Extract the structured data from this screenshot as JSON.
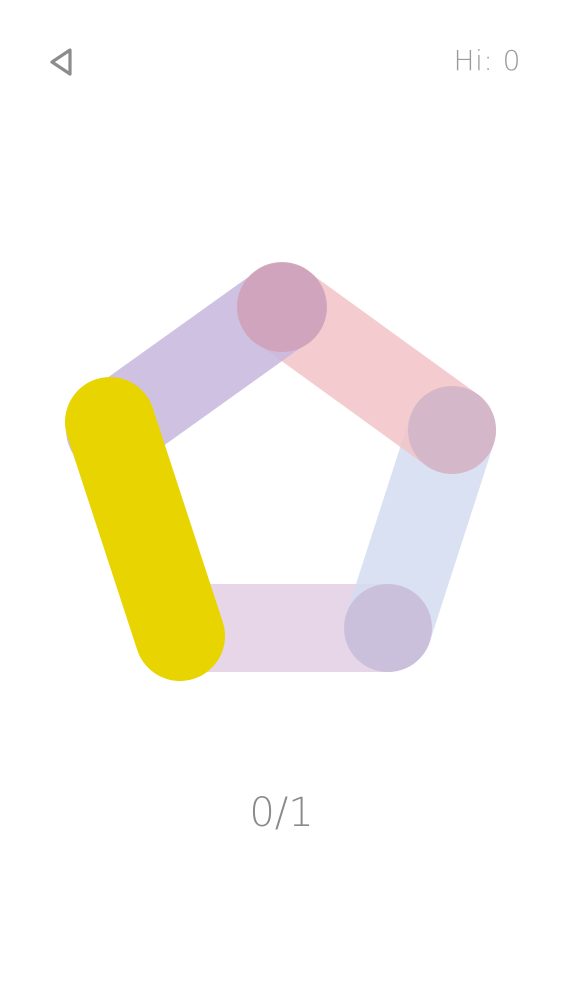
{
  "header": {
    "back_icon": "back-triangle-icon",
    "hi_score_label": "Hi: 0"
  },
  "game": {
    "progress_text": "0/1",
    "nodes": 5,
    "colors": {
      "active_segment": "#e8d400",
      "segment_top_left": "#c7b6dc",
      "segment_top_right": "#f2c3c8",
      "segment_right": "#d2dcf0",
      "segment_bottom": "#e3cfe3",
      "node_top": "#cfa2b8",
      "node_right": "#d0b6c9",
      "node_bottom_right": "#c9bdd8"
    }
  }
}
